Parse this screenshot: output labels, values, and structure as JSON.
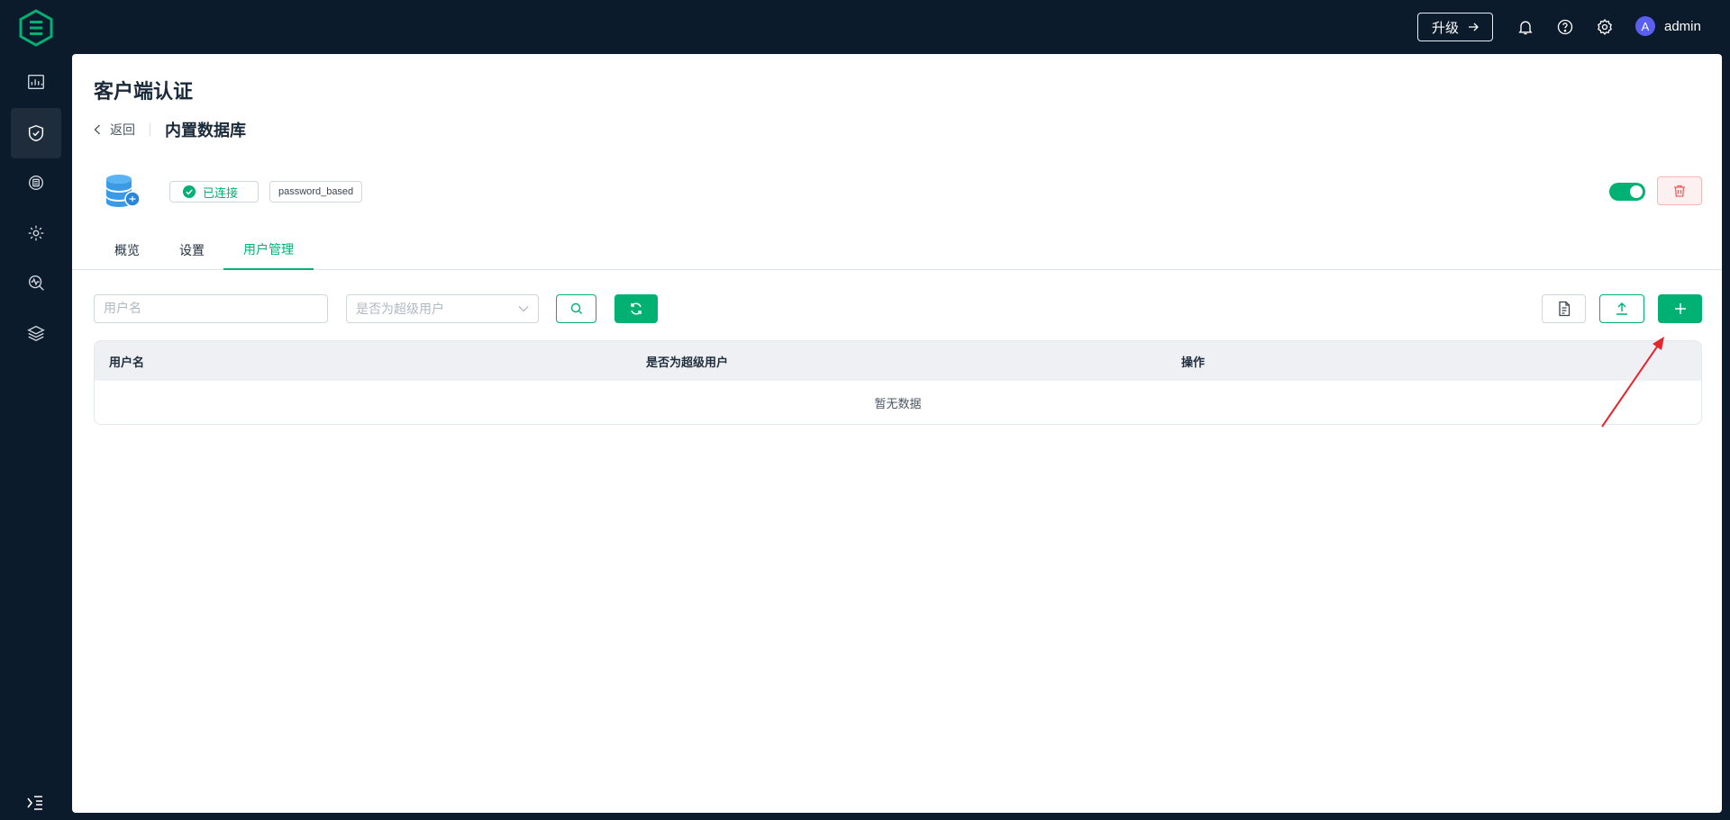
{
  "topbar": {
    "upgrade_label": "升级",
    "username": "admin",
    "avatar_letter": "A"
  },
  "page": {
    "title": "客户端认证",
    "back_label": "返回",
    "current": "内置数据库",
    "status_label": "已连接",
    "mechanism_label": "password_based",
    "enabled": true
  },
  "tabs": [
    {
      "label": "概览",
      "active": false
    },
    {
      "label": "设置",
      "active": false
    },
    {
      "label": "用户管理",
      "active": true
    }
  ],
  "filters": {
    "username_placeholder": "用户名",
    "superuser_placeholder": "是否为超级用户"
  },
  "table": {
    "columns": [
      "用户名",
      "是否为超级用户",
      "操作"
    ],
    "empty_text": "暂无数据"
  },
  "colors": {
    "accent": "#00b173",
    "sidebar_bg": "#0c1b2b",
    "annotation_arrow": "#e5252a"
  }
}
